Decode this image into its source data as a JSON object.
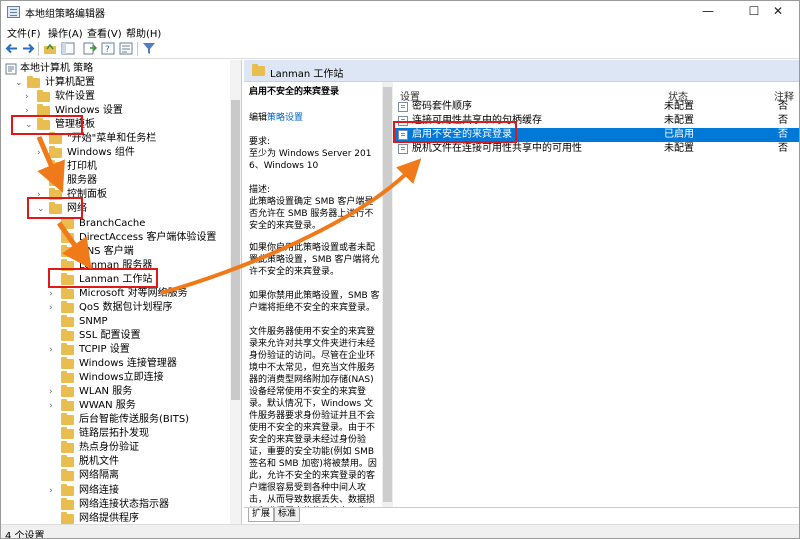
{
  "window": {
    "title": "本地组策略编辑器",
    "minimize": "—",
    "maximize": "☐",
    "close": "✕"
  },
  "menu": [
    "文件(F)",
    "操作(A)",
    "查看(V)",
    "帮助(H)"
  ],
  "tree": {
    "root": "本地计算机 策略",
    "items": [
      {
        "label": "计算机配置",
        "exp": "⌄"
      },
      {
        "label": "软件设置",
        "exp": "›"
      },
      {
        "label": "Windows 设置",
        "exp": "›"
      },
      {
        "label": "管理模板",
        "exp": "⌄"
      },
      {
        "label": "\"开始\"菜单和任务栏",
        "exp": "›"
      },
      {
        "label": "Windows 组件",
        "exp": "›"
      },
      {
        "label": "打印机",
        "exp": ""
      },
      {
        "label": "服务器",
        "exp": ""
      },
      {
        "label": "控制面板",
        "exp": "›"
      },
      {
        "label": "网络",
        "exp": "⌄"
      },
      {
        "label": "BranchCache",
        "exp": ""
      },
      {
        "label": "DirectAccess 客户端体验设置",
        "exp": ""
      },
      {
        "label": "DNS 客户端",
        "exp": ""
      },
      {
        "label": "Lanman 服务器",
        "exp": ""
      },
      {
        "label": "Lanman 工作站",
        "exp": ""
      },
      {
        "label": "Microsoft 对等网络服务",
        "exp": "›"
      },
      {
        "label": "QoS 数据包计划程序",
        "exp": "›"
      },
      {
        "label": "SNMP",
        "exp": ""
      },
      {
        "label": "SSL 配置设置",
        "exp": ""
      },
      {
        "label": "TCPIP 设置",
        "exp": "›"
      },
      {
        "label": "Windows 连接管理器",
        "exp": ""
      },
      {
        "label": "Windows立即连接",
        "exp": ""
      },
      {
        "label": "WLAN 服务",
        "exp": "›"
      },
      {
        "label": "WWAN 服务",
        "exp": "›"
      },
      {
        "label": "后台智能传送服务(BITS)",
        "exp": ""
      },
      {
        "label": "链路层拓扑发现",
        "exp": ""
      },
      {
        "label": "热点身份验证",
        "exp": ""
      },
      {
        "label": "脱机文件",
        "exp": ""
      },
      {
        "label": "网络隔离",
        "exp": ""
      },
      {
        "label": "网络连接",
        "exp": "›"
      },
      {
        "label": "网络连接状态指示器",
        "exp": ""
      },
      {
        "label": "网络提供程序",
        "exp": ""
      }
    ]
  },
  "panel": {
    "title": "Lanman 工作站"
  },
  "description": {
    "heading": "启用不安全的来宾登录",
    "edit_prefix": "编辑",
    "edit_link": "策略设置",
    "req_label": "要求:",
    "req_text": "至少为 Windows Server 2016、Windows 10",
    "desc_label": "描述:",
    "p1": "此策略设置确定 SMB 客户端是否允许在 SMB 服务器上进行不安全的来宾登录。",
    "p2": "如果你启用此策略设置或者未配置此策略设置，SMB 客户端将允许不安全的来宾登录。",
    "p3": "如果你禁用此策略设置，SMB 客户端将拒绝不安全的来宾登录。",
    "p4": "文件服务器使用不安全的来宾登录来允许对共享文件夹进行未经身份验证的访问。尽管在企业环境中不太常见，但充当文件服务器的消费型网络附加存储(NAS)设备经常使用不安全的来宾登录。默认情况下，Windows 文件服务器要求身份验证并且不会使用不安全的来宾登录。由于不安全的来宾登录未经过身份验证，重要的安全功能(例如 SMB 签名和 SMB 加密)将被禁用。因此，允许不安全的来宾登录的客户端很容易受到各种中间人攻击，从而导致数据丢失、数据损坏和遭受恶意软件的攻击。此外，可"
  },
  "list": {
    "headers": {
      "setting": "设置",
      "state": "状态",
      "comment": "注释"
    },
    "rows": [
      {
        "setting": "密码套件顺序",
        "state": "未配置",
        "comment": "否"
      },
      {
        "setting": "连接可用性共享中的句柄缓存",
        "state": "未配置",
        "comment": "否"
      },
      {
        "setting": "启用不安全的来宾登录",
        "state": "已启用",
        "comment": "否"
      },
      {
        "setting": "脱机文件在连接可用性共享中的可用性",
        "state": "未配置",
        "comment": "否"
      }
    ]
  },
  "tabs": [
    "扩展",
    "标准"
  ],
  "status": "4 个设置"
}
